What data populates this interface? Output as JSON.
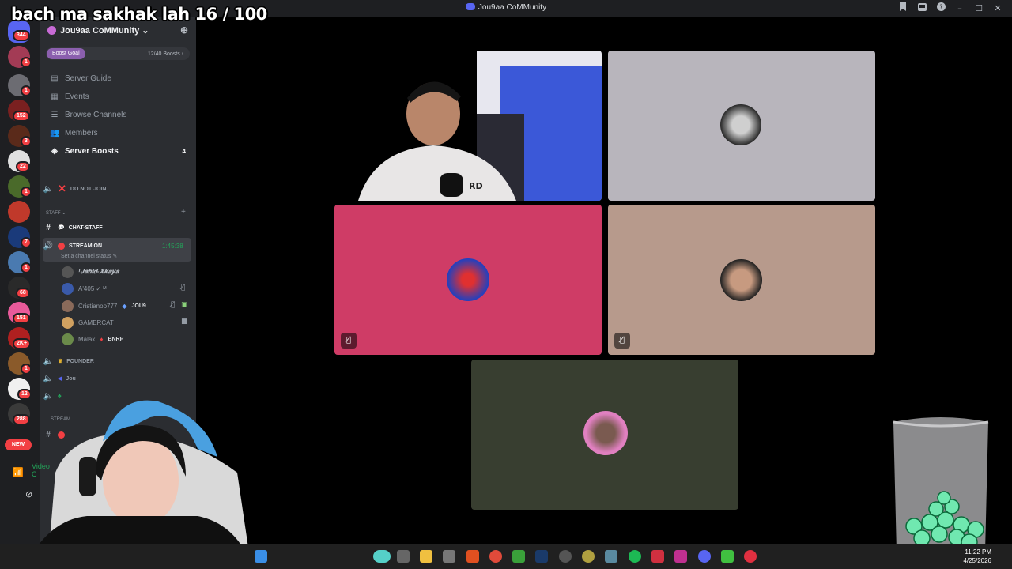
{
  "overlay": {
    "text": "bach ma sakhak lah 16 / 100"
  },
  "window": {
    "title": "Jou9aa CoMMunity"
  },
  "server": {
    "name": "Jou9aa CoMMunity ⌄",
    "boost_label": "Boost Goal",
    "boost_count": "12/40 Boosts ›",
    "nav": [
      {
        "label": "Server Guide",
        "icon": "guide-icon"
      },
      {
        "label": "Events",
        "icon": "calendar-icon"
      },
      {
        "label": "Browse Channels",
        "icon": "browse-icon"
      },
      {
        "label": "Members",
        "icon": "members-icon"
      },
      {
        "label": "Server Boosts",
        "icon": "boost-icon",
        "count": "4"
      }
    ]
  },
  "rail": {
    "badges": [
      "344",
      "1",
      "1",
      "1",
      "152",
      "3",
      "22",
      "1",
      "7",
      "1",
      "68",
      "151",
      "2K+",
      "1",
      "12",
      "288"
    ],
    "new_label": "NEW"
  },
  "channels": {
    "do_not_join": "DO NOT JOIN",
    "staff_category": "STAFF ⌄",
    "chat_staff": "CHAT-STAFF",
    "stream_on": "STREAM ON",
    "stream_time": "1:45:38",
    "set_status": "Set a channel status ✎",
    "members": [
      {
        "name": "!𝑱𝒂𝒉𝒊𝒅-𝑿𝒌𝒂𝒚𝒂",
        "tag": ""
      },
      {
        "name": "A'405 ✓ ᴹ",
        "tag": ""
      },
      {
        "name": "Cristianoo777",
        "tag": "JOU9"
      },
      {
        "name": "GAMERCAT",
        "tag": ""
      },
      {
        "name": "Malak",
        "tag": "BNRP"
      }
    ],
    "founder": "FOUNDER",
    "jou": "Jou",
    "stream_cat": "STREAM"
  },
  "voice": {
    "status": "Video C"
  },
  "tiles": [
    {
      "id": "webcam-host",
      "bg": "#3a3f66"
    },
    {
      "id": "jahid",
      "bg": "#b8b5bc"
    },
    {
      "id": "aminou",
      "bg": "#cf3c66"
    },
    {
      "id": "cristiano",
      "bg": "#b79a8c"
    },
    {
      "id": "malak",
      "bg": "#383e30"
    }
  ],
  "taskbar": {
    "time": "11:22 PM",
    "date": "4/25/2026"
  },
  "colors": {
    "accent": "#5865f2",
    "danger": "#f23f43",
    "online": "#23a55a"
  }
}
